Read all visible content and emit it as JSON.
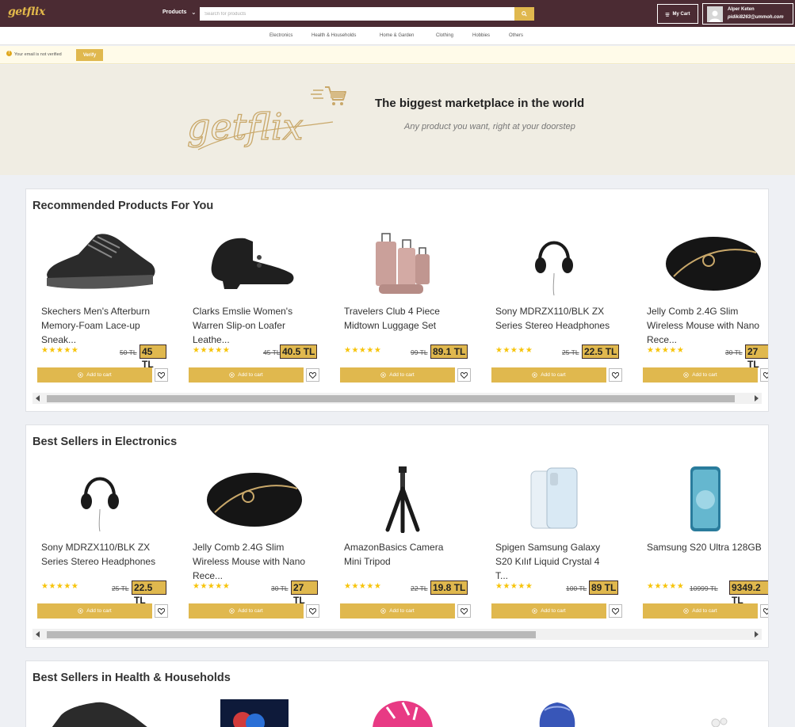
{
  "header": {
    "logo": "getflix",
    "products_label": "Products",
    "search_placeholder": "Search for products",
    "cart_label": "My Cart",
    "user_name": "Alper Keten",
    "user_email": "pidiki8263@ummoh.com"
  },
  "categories": [
    "Electronics",
    "Health & Households",
    "Home & Garden",
    "Clothing",
    "Hobbies",
    "Others"
  ],
  "verify": {
    "message": "Your email is not verified",
    "button": "Verify"
  },
  "hero": {
    "logo_text": "getflix",
    "tagline": "The biggest marketplace in the world",
    "subtitle": "Any product you want, right at your doorstep"
  },
  "add_to_cart_label": "Add to cart",
  "sections": [
    {
      "title": "Recommended Products For You",
      "products": [
        {
          "name": "Skechers Men's Afterburn Memory-Foam Lace-up Sneak...",
          "old_price": "50 TL",
          "price": "45 TL",
          "icon": "sneaker-image"
        },
        {
          "name": "Clarks Emslie Women's Warren Slip-on Loafer Leathe...",
          "old_price": "45 TL",
          "price": "40.5 TL",
          "icon": "loafer-image"
        },
        {
          "name": "Travelers Club 4 Piece Midtown Luggage Set",
          "old_price": "99 TL",
          "price": "89.1 TL",
          "icon": "luggage-image"
        },
        {
          "name": "Sony MDRZX110/BLK ZX Series Stereo Headphones",
          "old_price": "25 TL",
          "price": "22.5 TL",
          "icon": "headphones-image"
        },
        {
          "name": "Jelly Comb 2.4G Slim Wireless Mouse with Nano Rece...",
          "old_price": "30 TL",
          "price": "27 TL",
          "icon": "mouse-image"
        }
      ]
    },
    {
      "title": "Best Sellers in Electronics",
      "products": [
        {
          "name": "Sony MDRZX110/BLK ZX Series Stereo Headphones",
          "old_price": "25 TL",
          "price": "22.5 TL",
          "icon": "headphones-image"
        },
        {
          "name": "Jelly Comb 2.4G Slim Wireless Mouse with Nano Rece...",
          "old_price": "30 TL",
          "price": "27 TL",
          "icon": "mouse-image"
        },
        {
          "name": "AmazonBasics Camera Mini Tripod",
          "old_price": "22 TL",
          "price": "19.8 TL",
          "icon": "tripod-image"
        },
        {
          "name": "Spigen Samsung Galaxy S20 Kılıf Liquid Crystal 4 T...",
          "old_price": "100 TL",
          "price": "89 TL",
          "icon": "phone-case-image"
        },
        {
          "name": "Samsung S20 Ultra 128GB",
          "old_price": "10999 TL",
          "price": "9349.2 TL",
          "icon": "smartphone-image"
        }
      ]
    },
    {
      "title": "Best Sellers in Health & Households",
      "products": []
    }
  ],
  "colors": {
    "topbar": "#4b2b33",
    "accent": "#e0b84e",
    "star": "#f7c40b",
    "hero_bg": "#f0ede3"
  }
}
